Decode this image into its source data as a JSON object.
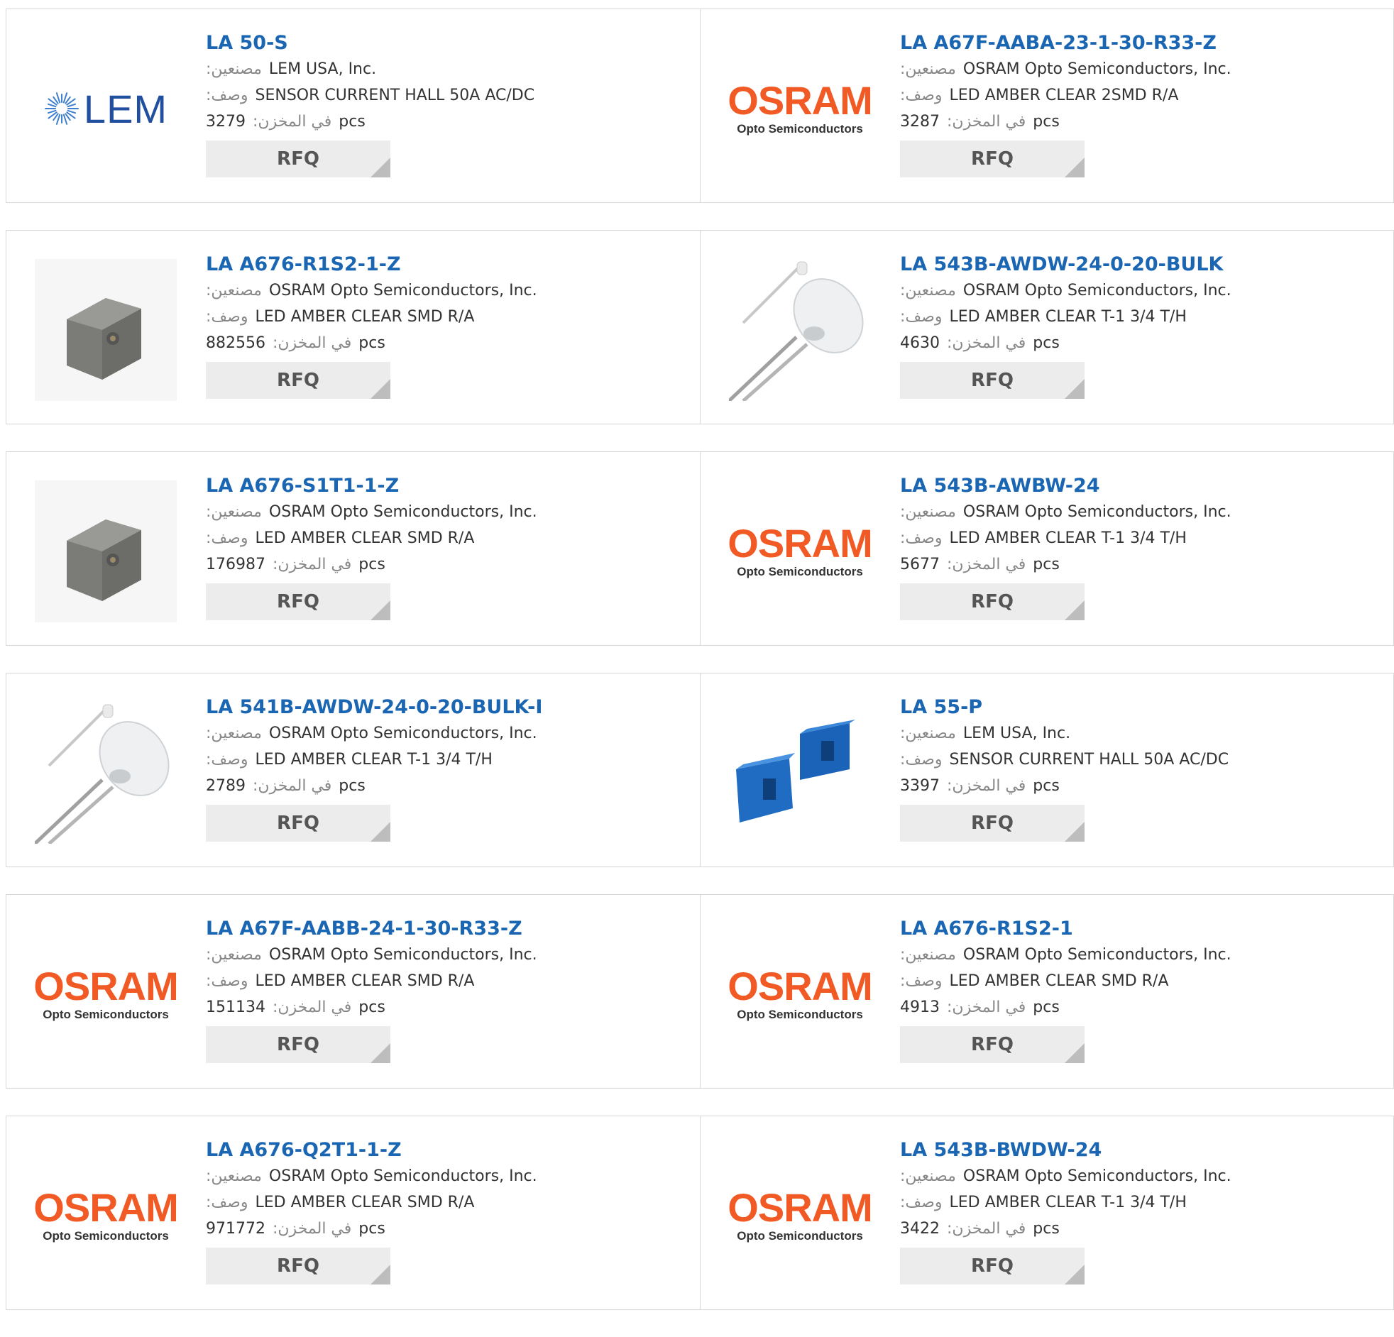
{
  "labels": {
    "manufacturer": "مصنعين:",
    "description": "وصف:",
    "stock": "في المخزن:",
    "pcs": "pcs",
    "rfq": "RFQ"
  },
  "brand": {
    "osram_word": "OSRAM",
    "osram_sub": "Opto Semiconductors",
    "lem_word": "LEM"
  },
  "colors": {
    "link": "#1a66b3",
    "osram": "#f15a24",
    "lem": "#1f4f9e",
    "button": "#ececec"
  },
  "products": [
    {
      "part": "LA 50-S",
      "manufacturer": "LEM USA, Inc.",
      "description": "SENSOR CURRENT HALL 50A AC/DC",
      "stock": "3279",
      "image": "lem-logo"
    },
    {
      "part": "LA A67F-AABA-23-1-30-R33-Z",
      "manufacturer": "OSRAM Opto Semiconductors, Inc.",
      "description": "LED AMBER CLEAR 2SMD R/A",
      "stock": "3287",
      "image": "osram-logo"
    },
    {
      "part": "LA A676-R1S2-1-Z",
      "manufacturer": "OSRAM Opto Semiconductors, Inc.",
      "description": "LED AMBER CLEAR SMD R/A",
      "stock": "882556",
      "image": "smd-led-photo"
    },
    {
      "part": "LA 543B-AWDW-24-0-20-BULK",
      "manufacturer": "OSRAM Opto Semiconductors, Inc.",
      "description": "LED AMBER CLEAR T-1 3/4 T/H",
      "stock": "4630",
      "image": "through-hole-led-photo"
    },
    {
      "part": "LA A676-S1T1-1-Z",
      "manufacturer": "OSRAM Opto Semiconductors, Inc.",
      "description": "LED AMBER CLEAR SMD R/A",
      "stock": "176987",
      "image": "smd-led-photo"
    },
    {
      "part": "LA 543B-AWBW-24",
      "manufacturer": "OSRAM Opto Semiconductors, Inc.",
      "description": "LED AMBER CLEAR T-1 3/4 T/H",
      "stock": "5677",
      "image": "osram-logo"
    },
    {
      "part": "LA 541B-AWDW-24-0-20-BULK-I",
      "manufacturer": "OSRAM Opto Semiconductors, Inc.",
      "description": "LED AMBER CLEAR T-1 3/4 T/H",
      "stock": "2789",
      "image": "through-hole-led-photo"
    },
    {
      "part": "LA 55-P",
      "manufacturer": "LEM USA, Inc.",
      "description": "SENSOR CURRENT HALL 50A AC/DC",
      "stock": "3397",
      "image": "current-sensor-photo"
    },
    {
      "part": "LA A67F-AABB-24-1-30-R33-Z",
      "manufacturer": "OSRAM Opto Semiconductors, Inc.",
      "description": "LED AMBER CLEAR SMD R/A",
      "stock": "151134",
      "image": "osram-logo"
    },
    {
      "part": "LA A676-R1S2-1",
      "manufacturer": "OSRAM Opto Semiconductors, Inc.",
      "description": "LED AMBER CLEAR SMD R/A",
      "stock": "4913",
      "image": "osram-logo"
    },
    {
      "part": "LA A676-Q2T1-1-Z",
      "manufacturer": "OSRAM Opto Semiconductors, Inc.",
      "description": "LED AMBER CLEAR SMD R/A",
      "stock": "971772",
      "image": "osram-logo"
    },
    {
      "part": "LA 543B-BWDW-24",
      "manufacturer": "OSRAM Opto Semiconductors, Inc.",
      "description": "LED AMBER CLEAR T-1 3/4 T/H",
      "stock": "3422",
      "image": "osram-logo"
    }
  ]
}
